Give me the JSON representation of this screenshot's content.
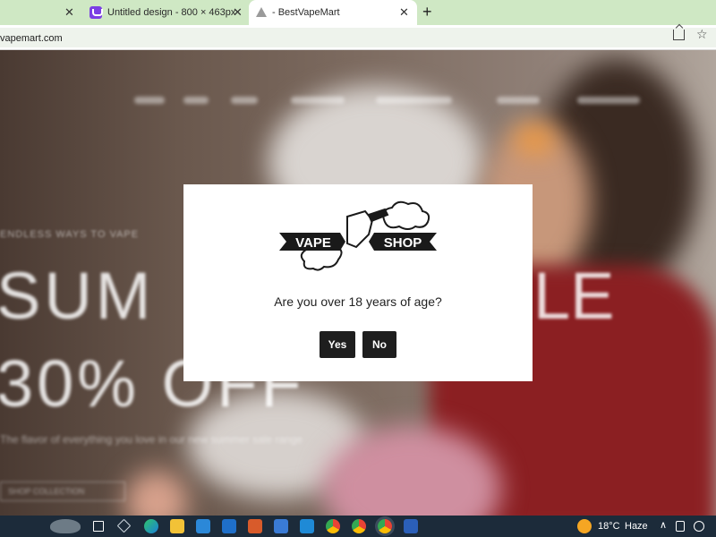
{
  "browser": {
    "tabs": [
      {
        "title": ""
      },
      {
        "title": "Untitled design - 800 × 463px"
      },
      {
        "title": "- BestVapeMart"
      }
    ],
    "close_glyph": "✕",
    "new_tab_glyph": "+",
    "url": "vapemart.com",
    "icons": [
      "design-app-icon",
      "website-favicon",
      "share-icon",
      "bookmark-star-icon"
    ]
  },
  "hero": {
    "kicker": "ENDLESS WAYS TO VAPE",
    "line1_left": "SUM",
    "line1_right": "LE",
    "line2": "30% OFF",
    "subtitle": "The flavor of everything you love in our new summer sale range",
    "button": "SHOP COLLECTION"
  },
  "modal": {
    "logo_left": "VAPE",
    "logo_right": "SHOP",
    "question": "Are you over 18 years of age?",
    "yes_label": "Yes",
    "no_label": "No"
  },
  "taskbar": {
    "temperature": "18°C",
    "weather": "Haze",
    "chevron": "∧",
    "icons": [
      "manatee-icon",
      "task-view-icon",
      "3d-viewer-icon",
      "edge-icon",
      "file-explorer-icon",
      "store-icon",
      "mail-icon",
      "paint-icon",
      "app-icon",
      "vscode-icon",
      "chrome-icon",
      "chrome-icon-2",
      "chrome-icon-3",
      "word-icon",
      "weather-icon"
    ]
  },
  "colors": {
    "tabstrip": "#cfe8c4",
    "modal_button": "#1e1e1e",
    "taskbar": "#1c2b3a"
  }
}
